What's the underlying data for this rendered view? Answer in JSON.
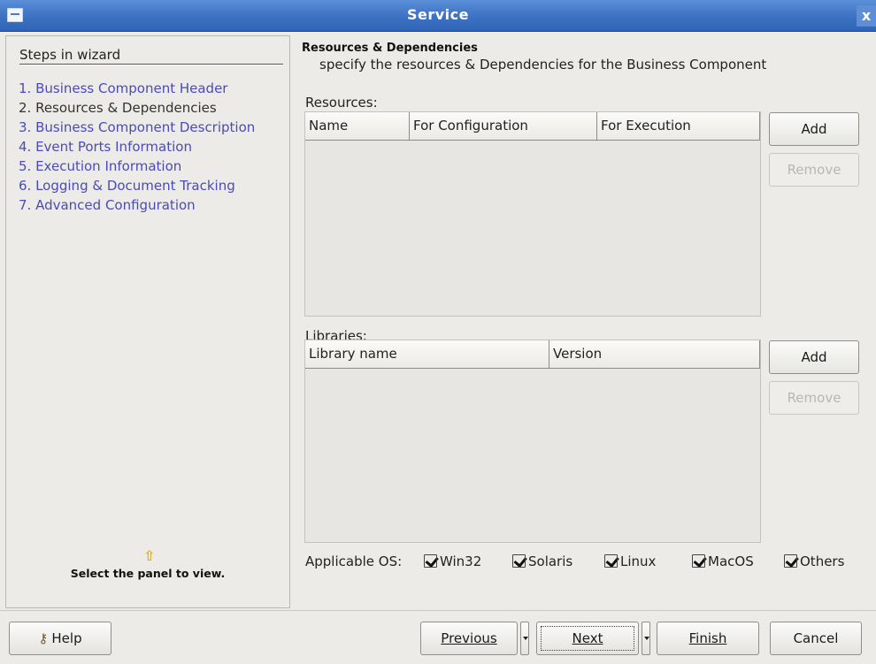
{
  "window": {
    "title": "Service",
    "close_glyph": "x"
  },
  "left_panel": {
    "heading": "Steps in wizard",
    "steps": [
      "1. Business Component Header",
      "2. Resources & Dependencies",
      "3. Business Component Description",
      "4. Event Ports Information",
      "5. Execution Information",
      "6. Logging & Document Tracking",
      "7. Advanced Configuration"
    ],
    "hint_icon": "arrow-up-icon",
    "hint_text": "Select the panel to view."
  },
  "right_panel": {
    "title": "Resources & Dependencies",
    "subtitle": "specify the resources & Dependencies for the Business Component",
    "resources": {
      "label": "Resources:",
      "columns": [
        "Name",
        "For Configuration",
        "For Execution"
      ],
      "rows": [],
      "add_label": "Add",
      "remove_label": "Remove"
    },
    "libraries": {
      "label": "Libraries:",
      "columns": [
        "Library name",
        "Version"
      ],
      "rows": [],
      "add_label": "Add",
      "remove_label": "Remove"
    },
    "os": {
      "label": "Applicable OS:",
      "options": [
        {
          "label": "Win32",
          "checked": true
        },
        {
          "label": "Solaris",
          "checked": true
        },
        {
          "label": "Linux",
          "checked": true
        },
        {
          "label": "MacOS",
          "checked": true
        },
        {
          "label": "Others",
          "checked": true
        }
      ]
    }
  },
  "footer": {
    "help_label": "Help",
    "previous_label": "Previous",
    "next_label": "Next",
    "finish_label": "Finish",
    "cancel_label": "Cancel"
  }
}
